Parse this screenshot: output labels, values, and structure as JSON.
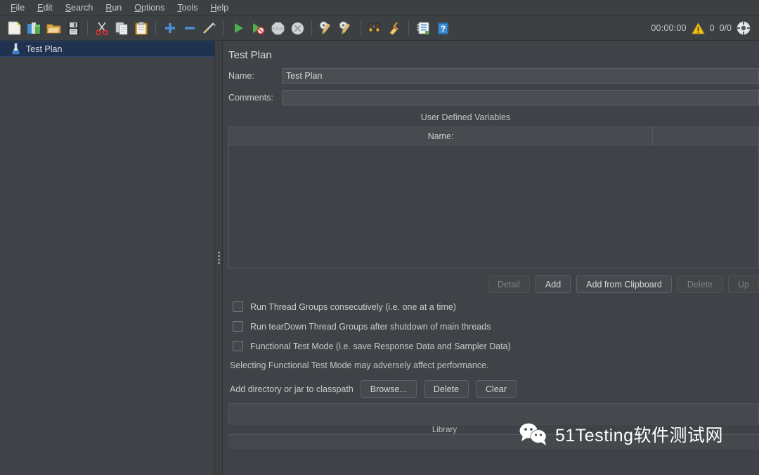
{
  "menubar": {
    "items": [
      {
        "label": "File",
        "mnemonic": "F"
      },
      {
        "label": "Edit",
        "mnemonic": "E"
      },
      {
        "label": "Search",
        "mnemonic": "S"
      },
      {
        "label": "Run",
        "mnemonic": "R"
      },
      {
        "label": "Options",
        "mnemonic": "O"
      },
      {
        "label": "Tools",
        "mnemonic": "T"
      },
      {
        "label": "Help",
        "mnemonic": "H"
      }
    ]
  },
  "toolbar": {
    "icons": [
      "new-file-icon",
      "templates-icon",
      "open-folder-icon",
      "save-icon",
      "cut-icon",
      "copy-icon",
      "paste-icon",
      "expand-icon",
      "collapse-icon",
      "toggle-icon",
      "start-icon",
      "start-no-pauses-icon",
      "stop-icon",
      "shutdown-icon",
      "clear-icon",
      "clear-all-icon",
      "search-icon",
      "search-reset-icon",
      "function-helper-icon",
      "help-icon"
    ],
    "status": {
      "elapsed_time": "00:00:00",
      "warning_count": "0",
      "threads": "0/0",
      "warning_icon": "warning-triangle-icon",
      "remote_icon": "remote-engines-icon"
    }
  },
  "tree": {
    "root": {
      "label": "Test Plan",
      "icon": "test-plan-flask-icon",
      "selected": true
    }
  },
  "main": {
    "title": "Test Plan",
    "name_label": "Name:",
    "name_value": "Test Plan",
    "comments_label": "Comments:",
    "comments_value": "",
    "udv": {
      "caption": "User Defined Variables",
      "columns": [
        "Name:",
        ""
      ],
      "rows": []
    },
    "udv_buttons": [
      {
        "label": "Detail",
        "enabled": false
      },
      {
        "label": "Add",
        "enabled": true
      },
      {
        "label": "Add from Clipboard",
        "enabled": true
      },
      {
        "label": "Delete",
        "enabled": false
      },
      {
        "label": "Up",
        "enabled": false
      }
    ],
    "checkboxes": [
      {
        "label": "Run Thread Groups consecutively (i.e. one at a time)",
        "checked": false
      },
      {
        "label": "Run tearDown Thread Groups after shutdown of main threads",
        "checked": false
      },
      {
        "label": "Functional Test Mode (i.e. save Response Data and Sampler Data)",
        "checked": false
      }
    ],
    "functional_note": "Selecting Functional Test Mode may adversely affect performance.",
    "classpath": {
      "label": "Add directory or jar to classpath",
      "buttons": [
        {
          "label": "Browse...",
          "enabled": true
        },
        {
          "label": "Delete",
          "enabled": true
        },
        {
          "label": "Clear",
          "enabled": true
        }
      ],
      "list_caption": "Library"
    }
  },
  "watermark": {
    "text": "51Testing软件测试网",
    "icon": "wechat-icon"
  },
  "colors": {
    "window_bg": "#3f4347",
    "toolbar_bg": "#3c4043",
    "selection_blue": "#1f3350",
    "text": "#c9cccf",
    "border": "#55595d",
    "warning_yellow": "#f0c419"
  }
}
